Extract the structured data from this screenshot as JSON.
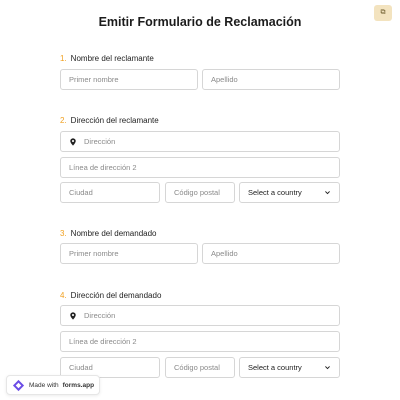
{
  "header": {
    "language_glyph": "⧉"
  },
  "form": {
    "title": "Emitir Formulario de Reclamación",
    "sections": [
      {
        "num": "1.",
        "label": "Nombre del reclamante",
        "first_placeholder": "Primer nombre",
        "last_placeholder": "Apellido"
      },
      {
        "num": "2.",
        "label": "Dirección del reclamante",
        "address_placeholder": "Dirección",
        "address2_placeholder": "Línea de dirección 2",
        "city_placeholder": "Ciudad",
        "postal_placeholder": "Código postal",
        "country_value": "Select a country"
      },
      {
        "num": "3.",
        "label": "Nombre del demandado",
        "first_placeholder": "Primer nombre",
        "last_placeholder": "Apellido"
      },
      {
        "num": "4.",
        "label": "Dirección del demandado",
        "address_placeholder": "Dirección",
        "address2_placeholder": "Línea de dirección 2",
        "city_placeholder": "Ciudad",
        "postal_placeholder": "Código postal",
        "country_value": "Select a country"
      }
    ]
  },
  "badge": {
    "prefix": "Made with",
    "brand": "forms.app"
  },
  "icons": {
    "pin": "map-pin-icon",
    "chevron": "chevron-down-icon",
    "logo": "forms-app-logo-icon"
  },
  "colors": {
    "accent": "#f0a020",
    "border": "#d6d6d6"
  }
}
